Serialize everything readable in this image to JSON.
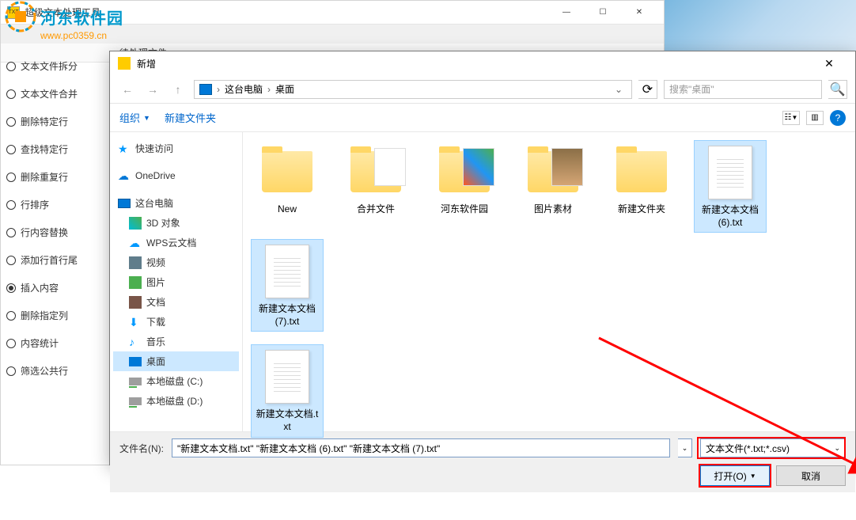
{
  "bg_window": {
    "title": "超级文本处理工具",
    "toolbar_label": "待处理文件"
  },
  "watermark": {
    "site_name": "河东软件园",
    "url": "www.pc0359.cn"
  },
  "side_options": [
    {
      "label": "文本文件拆分",
      "checked": false
    },
    {
      "label": "文本文件合并",
      "checked": false
    },
    {
      "label": "删除特定行",
      "checked": false
    },
    {
      "label": "查找特定行",
      "checked": false
    },
    {
      "label": "删除重复行",
      "checked": false
    },
    {
      "label": "行排序",
      "checked": false
    },
    {
      "label": "行内容替换",
      "checked": false
    },
    {
      "label": "添加行首行尾",
      "checked": false
    },
    {
      "label": "插入内容",
      "checked": true
    },
    {
      "label": "删除指定列",
      "checked": false
    },
    {
      "label": "内容统计",
      "checked": false
    },
    {
      "label": "筛选公共行",
      "checked": false
    }
  ],
  "dialog": {
    "title": "新增",
    "breadcrumb": {
      "root": "这台电脑",
      "current": "桌面"
    },
    "search_placeholder": "搜索\"桌面\"",
    "toolbar": {
      "organize": "组织",
      "new_folder": "新建文件夹"
    },
    "tree": {
      "quick_access": "快速访问",
      "onedrive": "OneDrive",
      "this_pc": "这台电脑",
      "objects_3d": "3D 对象",
      "wps_cloud": "WPS云文档",
      "videos": "视频",
      "pictures": "图片",
      "documents": "文档",
      "downloads": "下载",
      "music": "音乐",
      "desktop": "桌面",
      "disk_c": "本地磁盘 (C:)",
      "disk_d": "本地磁盘 (D:)"
    },
    "files": [
      {
        "name": "New",
        "type": "folder",
        "selected": false
      },
      {
        "name": "合并文件",
        "type": "folder",
        "selected": false
      },
      {
        "name": "河东软件园",
        "type": "folder-img1",
        "selected": false
      },
      {
        "name": "图片素材",
        "type": "folder-img2",
        "selected": false
      },
      {
        "name": "新建文件夹",
        "type": "folder",
        "selected": false
      },
      {
        "name": "新建文本文档 (6).txt",
        "type": "txt",
        "selected": true
      },
      {
        "name": "新建文本文档 (7).txt",
        "type": "txt",
        "selected": true
      },
      {
        "name": "新建文本文档.txt",
        "type": "txt",
        "selected": true
      }
    ],
    "filename_label": "文件名(N):",
    "filename_value": "\"新建文本文档.txt\" \"新建文本文档 (6).txt\" \"新建文本文档 (7).txt\"",
    "filter": "文本文件(*.txt;*.csv)",
    "open_btn": "打开(O)",
    "cancel_btn": "取消"
  }
}
